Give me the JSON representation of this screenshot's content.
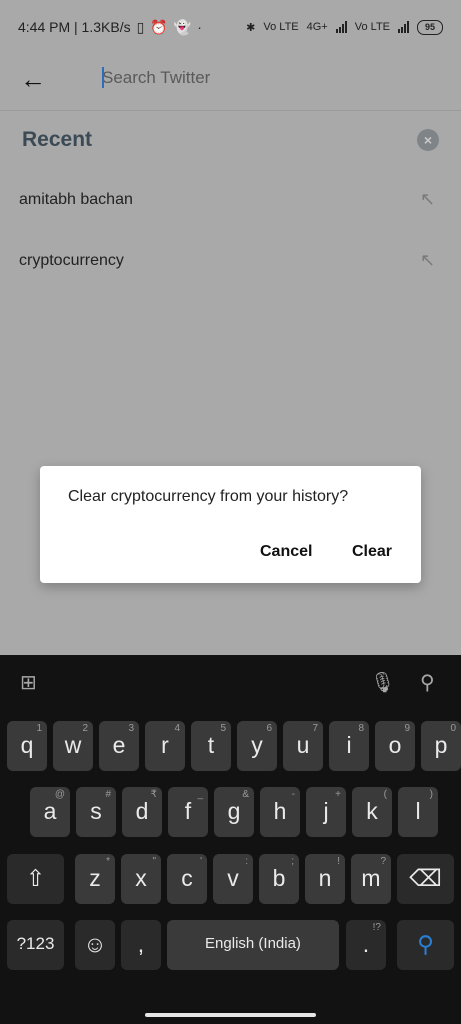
{
  "status": {
    "time_speed": "4:44 PM | 1.3KB/s",
    "dot": "·",
    "volte1": "Vo LTE",
    "net": "4G+",
    "volte2": "Vo LTE",
    "battery": "95"
  },
  "search": {
    "placeholder": "Search Twitter"
  },
  "recent": {
    "title": "Recent",
    "items": [
      "amitabh bachan",
      "cryptocurrency"
    ]
  },
  "dialog": {
    "message": "Clear cryptocurrency from your history?",
    "cancel": "Cancel",
    "clear": "Clear"
  },
  "keyboard": {
    "row1": [
      [
        "q",
        "1"
      ],
      [
        "w",
        "2"
      ],
      [
        "e",
        "3"
      ],
      [
        "r",
        "4"
      ],
      [
        "t",
        "5"
      ],
      [
        "y",
        "6"
      ],
      [
        "u",
        "7"
      ],
      [
        "i",
        "8"
      ],
      [
        "o",
        "9"
      ],
      [
        "p",
        "0"
      ]
    ],
    "row2": [
      [
        "a",
        "@"
      ],
      [
        "s",
        "#"
      ],
      [
        "d",
        "₹"
      ],
      [
        "f",
        "_"
      ],
      [
        "g",
        "&"
      ],
      [
        "h",
        "-"
      ],
      [
        "j",
        "+"
      ],
      [
        "k",
        "("
      ],
      [
        "l",
        ")"
      ]
    ],
    "row3": [
      [
        "z",
        "*"
      ],
      [
        "x",
        "\""
      ],
      [
        "c",
        "'"
      ],
      [
        "v",
        ":"
      ],
      [
        "b",
        ";"
      ],
      [
        "n",
        "!"
      ],
      [
        "m",
        "?"
      ]
    ],
    "sym_key": "?123",
    "comma": ",",
    "space": "English (India)",
    "period": ".",
    "period_sup": "!?"
  }
}
